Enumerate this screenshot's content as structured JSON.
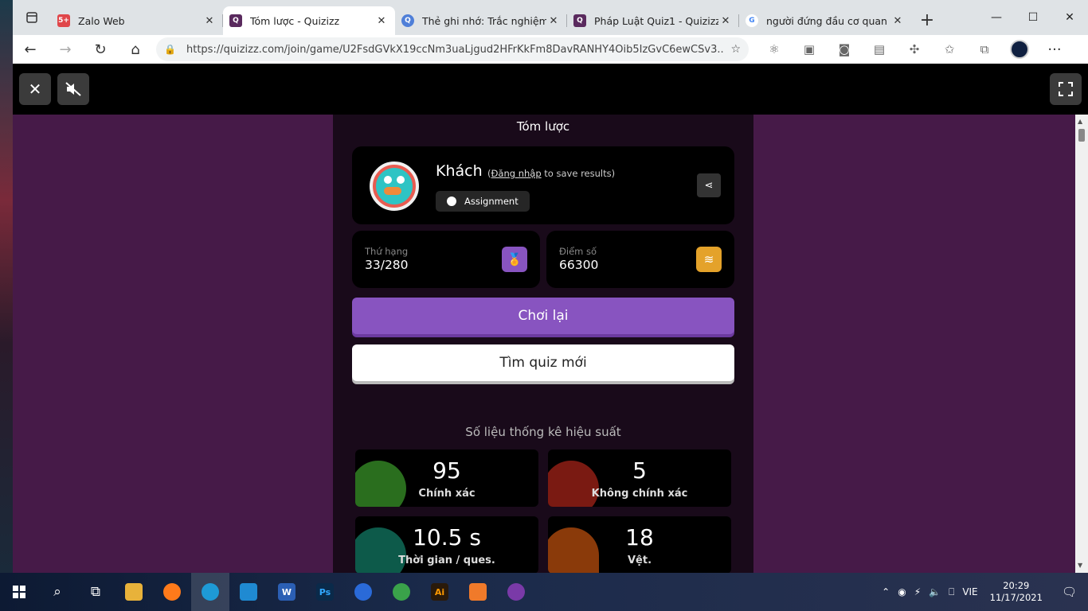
{
  "tabs": [
    {
      "title": "Zalo Web",
      "fav_color": "#e0464a",
      "fav_text": "5+"
    },
    {
      "title": "Tóm lược - Quizizz",
      "fav_color": "#5a2a5e",
      "fav_text": "Q",
      "active": true
    },
    {
      "title": "Thẻ ghi nhớ: Trắc nghiệm | Q",
      "fav_color": "#4f7fd8",
      "fav_text": "Q"
    },
    {
      "title": "Pháp Luật Quiz1 - Quizizz",
      "fav_color": "#5a2a5e",
      "fav_text": "Q"
    },
    {
      "title": "người đứng đầu cơ quan hàn",
      "fav_color": "#ffffff",
      "fav_text": "G"
    }
  ],
  "address": {
    "url": "https://quizizz.com/join/game/U2FsdGVkX19ccNm3uaLjgud2HFrKkFm8DavRANHY4Oib5IzGvC6ewCSv3..."
  },
  "summary": {
    "heading": "Tóm lược",
    "name": "Khách",
    "login_link": "Đăng nhập",
    "login_suffix": " to save results)",
    "login_prefix": "(",
    "badge": "Assignment",
    "rank_label": "Thứ hạng",
    "rank_value": "33/280",
    "score_label": "Điểm số",
    "score_value": "66300",
    "play_again": "Chơi lại",
    "find_quiz": "Tìm quiz mới"
  },
  "performance": {
    "title": "Số liệu thống kê hiệu suất",
    "items": [
      {
        "value": "95",
        "caption": "Chính xác",
        "color": "#2a6e1e"
      },
      {
        "value": "5",
        "caption": "Không chính xác",
        "color": "#7a1a12"
      },
      {
        "value": "10.5 s",
        "caption": "Thời gian / ques.",
        "color": "#0d5a4a"
      },
      {
        "value": "18",
        "caption": "Vệt.",
        "color": "#8a3a0a"
      }
    ]
  },
  "taskbar": {
    "lang": "VIE",
    "time": "20:29",
    "date": "11/17/2021"
  },
  "colors": {
    "page_bg": "#461a48",
    "play_button": "#8854c0",
    "rank_icon": "#8854c0",
    "score_icon": "#e4a22a"
  }
}
